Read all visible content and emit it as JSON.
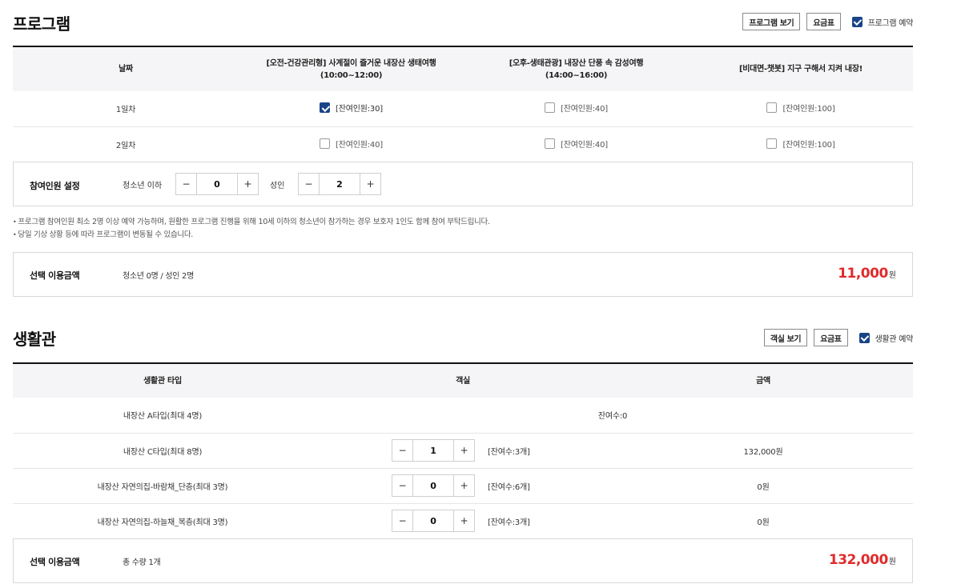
{
  "program": {
    "title": "프로그램",
    "view_button": "프로그램 보기",
    "price_button": "요금표",
    "reserve_label": "프로그램 예약",
    "reserve_checked": true,
    "table": {
      "headers": [
        {
          "line1": "날짜",
          "line2": ""
        },
        {
          "line1": "[오전-건강관리형] 사계절이 즐거운 내장산 생태여행",
          "line2": "(10:00~12:00)"
        },
        {
          "line1": "[오후-생태관광] 내장산 단풍 속 감성여행",
          "line2": "(14:00~16:00)"
        },
        {
          "line1": "[비대면-챗봇] 지구 구해서 지켜 내장!",
          "line2": ""
        }
      ],
      "rows": [
        {
          "day": "1일차",
          "options": [
            {
              "text": "[잔여인원:30]",
              "checked": true
            },
            {
              "text": "[잔여인원:40]",
              "checked": false
            },
            {
              "text": "[잔여인원:100]",
              "checked": false
            }
          ]
        },
        {
          "day": "2일차",
          "options": [
            {
              "text": "[잔여인원:40]",
              "checked": false
            },
            {
              "text": "[잔여인원:40]",
              "checked": false
            },
            {
              "text": "[잔여인원:100]",
              "checked": false
            }
          ]
        }
      ]
    },
    "participants": {
      "label": "참여인원 설정",
      "youth_label": "청소년 이하",
      "youth_value": "0",
      "adult_label": "성인",
      "adult_value": "2",
      "minus": "−",
      "plus": "+"
    },
    "notes": [
      "프로그램 참여인원 최소 2명 이상 예약 가능하며, 원활한 프로그램 진행을 위해 10세 이하의 청소년이 참가하는 경우 보호자 1인도 함께 참여 부탁드립니다.",
      "당일 기상 상황 등에 따라 프로그램이 변동될 수 있습니다."
    ],
    "summary": {
      "label": "선택 이용금액",
      "text": "청소년 0명 / 성인 2명",
      "amount": "11,000",
      "unit": "원"
    }
  },
  "lodging": {
    "title": "생활관",
    "view_button": "객실 보기",
    "price_button": "요금표",
    "reserve_label": "생활관 예약",
    "reserve_checked": true,
    "table": {
      "headers": [
        "생활관 타입",
        "객실",
        "금액"
      ],
      "rows": [
        {
          "type": "내장산 A타입(최대 4명)",
          "remaining": "잔여수:0"
        },
        {
          "type": "내장산 C타입(최대 8명)",
          "qty": "1",
          "remaining": "[잔여수:3개]",
          "price": "132,000원"
        },
        {
          "type": "내장산 자연의집-바람채_단층(최대 3명)",
          "qty": "0",
          "remaining": "[잔여수:6개]",
          "price": "0원"
        },
        {
          "type": "내장산 자연의집-하늘채_복층(최대 3명)",
          "qty": "0",
          "remaining": "[잔여수:3개]",
          "price": "0원"
        }
      ]
    },
    "summary": {
      "label": "선택 이용금액",
      "text": "총 수량 1개",
      "amount": "132,000",
      "unit": "원"
    }
  },
  "stepper": {
    "minus": "−",
    "plus": "+"
  },
  "colors": {
    "accent": "#1a4488",
    "price": "#e02b2b",
    "header_bg": "#f5f5f7"
  }
}
